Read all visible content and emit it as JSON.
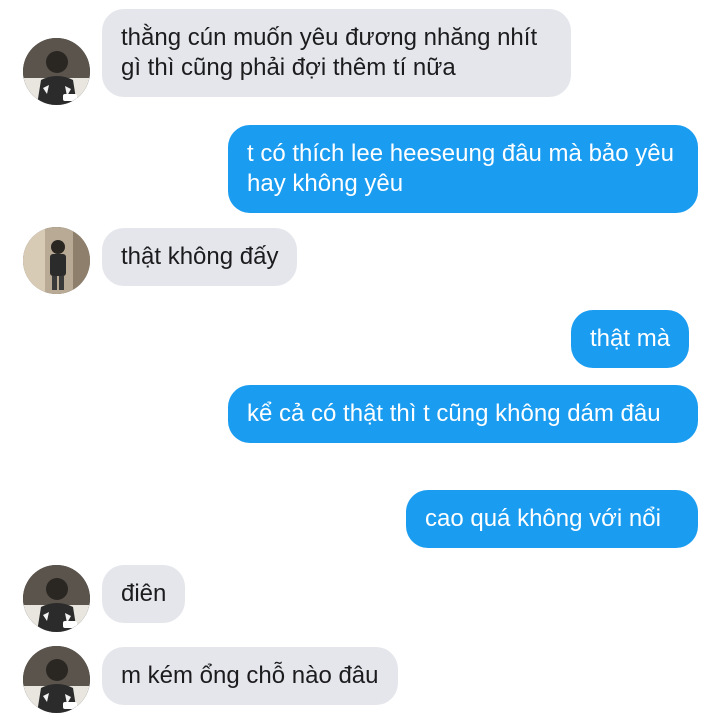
{
  "theme": {
    "incoming_bg": "#e4e6eb",
    "outgoing_bg": "#1a9cf0",
    "incoming_text": "#1c1c1e",
    "outgoing_text": "#ffffff"
  },
  "messages": [
    {
      "sender": "them",
      "text": "thằng cún muốn yêu đương nhăng nhít gì thì cũng phải đợi thêm tí nữa"
    },
    {
      "sender": "me",
      "text": "t có thích lee heeseung đâu mà bảo yêu hay không yêu"
    },
    {
      "sender": "them",
      "text": "thật không đấy"
    },
    {
      "sender": "me",
      "text": "thật mà"
    },
    {
      "sender": "me",
      "text": "kể cả có thật thì t cũng không dám đâu"
    },
    {
      "sender": "me",
      "text": "cao quá không với nổi"
    },
    {
      "sender": "them",
      "text": "điên"
    },
    {
      "sender": "them",
      "text": "m kém ổng chỗ nào đâu"
    }
  ],
  "avatars": [
    {
      "icon": "contact-avatar-photo"
    },
    {
      "icon": "contact-avatar-photo"
    },
    {
      "icon": "contact-avatar-photo"
    },
    {
      "icon": "contact-avatar-photo"
    }
  ]
}
